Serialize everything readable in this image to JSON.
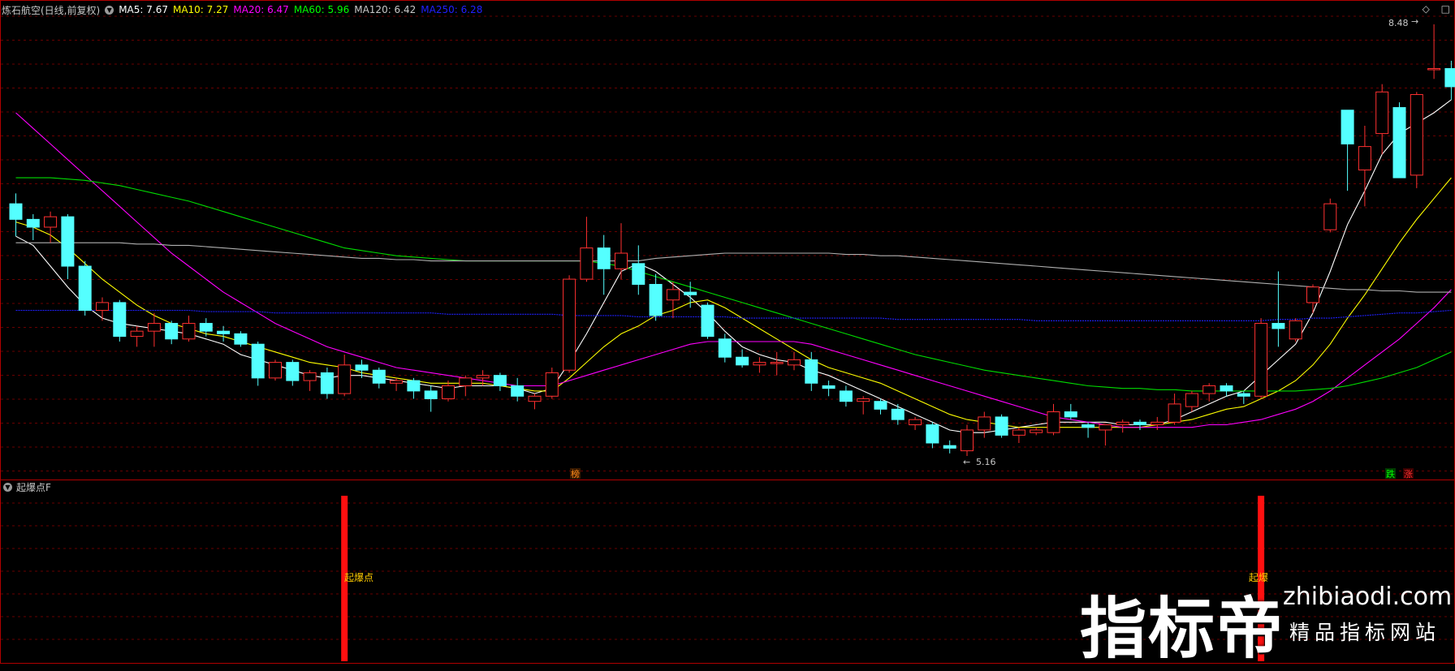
{
  "header": {
    "title": "炼石航空(日线,前复权)",
    "ma_indicators": [
      {
        "label": "MA5: 7.67",
        "color": "#ffffff"
      },
      {
        "label": "MA10: 7.27",
        "color": "#ffff00"
      },
      {
        "label": "MA20: 6.47",
        "color": "#ff00ff"
      },
      {
        "label": "MA60: 5.96",
        "color": "#00ff00"
      },
      {
        "label": "MA120: 6.42",
        "color": "#c8c8c8"
      },
      {
        "label": "MA250: 6.28",
        "color": "#0000ff"
      }
    ],
    "corner_icons": [
      "diamond-icon",
      "square-icon"
    ]
  },
  "main_chart": {
    "high_label": "8.48",
    "low_label": "5.16",
    "markers": [
      {
        "text": "榜",
        "color": "#ff8c1a"
      },
      {
        "text": "跌",
        "color": "#00ff00"
      },
      {
        "text": "涨",
        "color": "#ff3030"
      }
    ]
  },
  "sub_chart": {
    "title": "起爆点F",
    "signal_label": "起爆点",
    "signal_label_2": "起爆"
  },
  "watermark": {
    "brand": "指标帝",
    "url": "zhibiaodi.com",
    "slogan": "精品指标网站"
  },
  "colors": {
    "up": "#ff3030",
    "down": "#54ffff",
    "grid": "#8b0000",
    "border": "#b00000",
    "signal": "#ff1010"
  },
  "candles": [
    [
      7.1,
      7.18,
      6.85,
      6.98
    ],
    [
      6.98,
      7.02,
      6.82,
      6.92
    ],
    [
      6.92,
      7.04,
      6.8,
      7.0
    ],
    [
      7.0,
      7.02,
      6.52,
      6.62
    ],
    [
      6.62,
      6.66,
      6.24,
      6.28
    ],
    [
      6.28,
      6.38,
      6.2,
      6.34
    ],
    [
      6.34,
      6.36,
      6.04,
      6.08
    ],
    [
      6.08,
      6.16,
      6.0,
      6.12
    ],
    [
      6.12,
      6.26,
      6.0,
      6.18
    ],
    [
      6.18,
      6.2,
      6.02,
      6.06
    ],
    [
      6.06,
      6.24,
      6.04,
      6.18
    ],
    [
      6.18,
      6.22,
      6.08,
      6.12
    ],
    [
      6.12,
      6.16,
      6.04,
      6.1
    ],
    [
      6.1,
      6.12,
      6.0,
      6.02
    ],
    [
      6.02,
      6.04,
      5.7,
      5.76
    ],
    [
      5.76,
      5.9,
      5.74,
      5.88
    ],
    [
      5.88,
      5.9,
      5.7,
      5.74
    ],
    [
      5.74,
      5.82,
      5.66,
      5.8
    ],
    [
      5.8,
      5.84,
      5.6,
      5.64
    ],
    [
      5.64,
      5.94,
      5.62,
      5.86
    ],
    [
      5.86,
      5.9,
      5.76,
      5.82
    ],
    [
      5.82,
      5.84,
      5.68,
      5.72
    ],
    [
      5.72,
      5.76,
      5.66,
      5.74
    ],
    [
      5.74,
      5.76,
      5.6,
      5.66
    ],
    [
      5.66,
      5.7,
      5.5,
      5.6
    ],
    [
      5.6,
      5.74,
      5.58,
      5.7
    ],
    [
      5.7,
      5.78,
      5.62,
      5.76
    ],
    [
      5.76,
      5.82,
      5.7,
      5.78
    ],
    [
      5.78,
      5.8,
      5.66,
      5.7
    ],
    [
      5.7,
      5.76,
      5.58,
      5.62
    ],
    [
      5.58,
      5.64,
      5.52,
      5.62
    ],
    [
      5.62,
      5.84,
      5.6,
      5.8
    ],
    [
      5.82,
      6.55,
      5.8,
      6.52
    ],
    [
      6.52,
      7.0,
      6.5,
      6.76
    ],
    [
      6.76,
      6.86,
      6.4,
      6.6
    ],
    [
      6.6,
      6.95,
      6.52,
      6.72
    ],
    [
      6.64,
      6.78,
      6.4,
      6.48
    ],
    [
      6.48,
      6.56,
      6.2,
      6.24
    ],
    [
      6.36,
      6.5,
      6.22,
      6.44
    ],
    [
      6.42,
      6.5,
      6.3,
      6.4
    ],
    [
      6.32,
      6.34,
      6.06,
      6.08
    ],
    [
      6.06,
      6.1,
      5.88,
      5.92
    ],
    [
      5.92,
      5.98,
      5.84,
      5.86
    ],
    [
      5.86,
      5.92,
      5.8,
      5.88
    ],
    [
      5.88,
      5.96,
      5.78,
      5.88
    ],
    [
      5.86,
      5.96,
      5.82,
      5.9
    ],
    [
      5.9,
      5.96,
      5.66,
      5.72
    ],
    [
      5.7,
      5.74,
      5.62,
      5.68
    ],
    [
      5.66,
      5.7,
      5.54,
      5.58
    ],
    [
      5.58,
      5.62,
      5.48,
      5.6
    ],
    [
      5.58,
      5.6,
      5.48,
      5.52
    ],
    [
      5.52,
      5.56,
      5.4,
      5.44
    ],
    [
      5.4,
      5.46,
      5.36,
      5.44
    ],
    [
      5.4,
      5.42,
      5.22,
      5.26
    ],
    [
      5.24,
      5.28,
      5.18,
      5.22
    ],
    [
      5.2,
      5.4,
      5.16,
      5.36
    ],
    [
      5.36,
      5.5,
      5.3,
      5.46
    ],
    [
      5.46,
      5.48,
      5.3,
      5.32
    ],
    [
      5.32,
      5.38,
      5.26,
      5.36
    ],
    [
      5.34,
      5.38,
      5.32,
      5.36
    ],
    [
      5.34,
      5.56,
      5.32,
      5.5
    ],
    [
      5.5,
      5.56,
      5.44,
      5.46
    ],
    [
      5.4,
      5.42,
      5.3,
      5.38
    ],
    [
      5.36,
      5.4,
      5.24,
      5.4
    ],
    [
      5.4,
      5.44,
      5.34,
      5.42
    ],
    [
      5.42,
      5.44,
      5.36,
      5.4
    ],
    [
      5.4,
      5.46,
      5.36,
      5.42
    ],
    [
      5.42,
      5.64,
      5.4,
      5.56
    ],
    [
      5.54,
      5.66,
      5.5,
      5.64
    ],
    [
      5.64,
      5.72,
      5.58,
      5.7
    ],
    [
      5.7,
      5.72,
      5.62,
      5.66
    ],
    [
      5.64,
      5.66,
      5.56,
      5.62
    ],
    [
      5.62,
      6.22,
      5.6,
      6.18
    ],
    [
      6.18,
      6.58,
      6.0,
      6.14
    ],
    [
      6.06,
      6.22,
      6.04,
      6.2
    ],
    [
      6.34,
      6.48,
      6.26,
      6.46
    ],
    [
      6.9,
      7.14,
      6.88,
      7.1
    ],
    [
      7.82,
      7.82,
      7.2,
      7.56
    ],
    [
      7.36,
      7.7,
      7.08,
      7.54
    ],
    [
      7.64,
      8.02,
      7.48,
      7.96
    ],
    [
      7.84,
      7.88,
      7.3,
      7.3
    ],
    [
      7.32,
      7.96,
      7.22,
      7.94
    ],
    [
      8.14,
      8.48,
      8.06,
      8.14
    ],
    [
      8.14,
      8.2,
      7.9,
      8.0
    ]
  ],
  "ma_series": {
    "ma5": [
      6.85,
      6.78,
      6.62,
      6.46,
      6.32,
      6.22,
      6.18,
      6.16,
      6.14,
      6.12,
      6.1,
      6.06,
      6.02,
      5.94,
      5.9,
      5.86,
      5.82,
      5.78,
      5.76,
      5.78,
      5.78,
      5.76,
      5.74,
      5.72,
      5.7,
      5.68,
      5.7,
      5.7,
      5.7,
      5.68,
      5.64,
      5.68,
      5.88,
      6.1,
      6.34,
      6.58,
      6.64,
      6.58,
      6.48,
      6.38,
      6.26,
      6.12,
      6.0,
      5.94,
      5.9,
      5.88,
      5.82,
      5.78,
      5.72,
      5.66,
      5.6,
      5.54,
      5.48,
      5.42,
      5.36,
      5.34,
      5.34,
      5.36,
      5.38,
      5.4,
      5.42,
      5.42,
      5.42,
      5.42,
      5.4,
      5.4,
      5.4,
      5.44,
      5.5,
      5.56,
      5.62,
      5.66,
      5.78,
      5.9,
      6.02,
      6.26,
      6.58,
      6.94,
      7.2,
      7.48,
      7.64,
      7.72,
      7.8,
      7.9
    ],
    "ma10": [
      6.96,
      6.92,
      6.86,
      6.76,
      6.64,
      6.52,
      6.42,
      6.32,
      6.24,
      6.18,
      6.14,
      6.1,
      6.08,
      6.04,
      6.0,
      5.96,
      5.92,
      5.88,
      5.86,
      5.84,
      5.8,
      5.78,
      5.76,
      5.74,
      5.72,
      5.72,
      5.72,
      5.72,
      5.7,
      5.68,
      5.66,
      5.66,
      5.76,
      5.88,
      6.0,
      6.1,
      6.16,
      6.24,
      6.28,
      6.34,
      6.36,
      6.3,
      6.22,
      6.14,
      6.06,
      5.98,
      5.9,
      5.84,
      5.8,
      5.76,
      5.72,
      5.66,
      5.6,
      5.54,
      5.48,
      5.44,
      5.42,
      5.4,
      5.38,
      5.38,
      5.38,
      5.38,
      5.38,
      5.38,
      5.38,
      5.38,
      5.4,
      5.42,
      5.44,
      5.48,
      5.52,
      5.54,
      5.6,
      5.66,
      5.74,
      5.86,
      6.02,
      6.22,
      6.4,
      6.6,
      6.8,
      6.98,
      7.14,
      7.3
    ],
    "ma20": [
      7.8,
      7.68,
      7.56,
      7.44,
      7.32,
      7.2,
      7.08,
      6.96,
      6.84,
      6.72,
      6.62,
      6.52,
      6.42,
      6.34,
      6.26,
      6.18,
      6.12,
      6.06,
      6.0,
      5.96,
      5.92,
      5.88,
      5.84,
      5.82,
      5.8,
      5.78,
      5.76,
      5.74,
      5.72,
      5.7,
      5.7,
      5.7,
      5.74,
      5.78,
      5.82,
      5.86,
      5.9,
      5.94,
      5.98,
      6.02,
      6.04,
      6.04,
      6.04,
      6.04,
      6.04,
      6.04,
      6.02,
      5.98,
      5.94,
      5.9,
      5.86,
      5.82,
      5.78,
      5.74,
      5.7,
      5.66,
      5.62,
      5.58,
      5.54,
      5.5,
      5.46,
      5.44,
      5.42,
      5.4,
      5.38,
      5.38,
      5.38,
      5.38,
      5.38,
      5.4,
      5.4,
      5.42,
      5.44,
      5.48,
      5.52,
      5.58,
      5.66,
      5.76,
      5.86,
      5.96,
      6.06,
      6.18,
      6.3,
      6.44
    ],
    "ma60": [
      7.3,
      7.3,
      7.3,
      7.29,
      7.28,
      7.26,
      7.24,
      7.21,
      7.18,
      7.15,
      7.12,
      7.08,
      7.04,
      7.0,
      6.96,
      6.92,
      6.88,
      6.84,
      6.8,
      6.76,
      6.74,
      6.72,
      6.7,
      6.69,
      6.68,
      6.67,
      6.66,
      6.66,
      6.66,
      6.66,
      6.66,
      6.66,
      6.66,
      6.66,
      6.64,
      6.62,
      6.58,
      6.54,
      6.5,
      6.46,
      6.42,
      6.38,
      6.34,
      6.3,
      6.26,
      6.22,
      6.18,
      6.14,
      6.1,
      6.06,
      6.02,
      5.98,
      5.94,
      5.91,
      5.88,
      5.85,
      5.82,
      5.8,
      5.78,
      5.76,
      5.74,
      5.72,
      5.7,
      5.69,
      5.68,
      5.68,
      5.67,
      5.67,
      5.66,
      5.66,
      5.66,
      5.66,
      5.66,
      5.66,
      5.66,
      5.67,
      5.68,
      5.7,
      5.73,
      5.76,
      5.8,
      5.84,
      5.9,
      5.96
    ],
    "ma120": [
      6.8,
      6.8,
      6.8,
      6.8,
      6.8,
      6.8,
      6.8,
      6.79,
      6.79,
      6.78,
      6.78,
      6.77,
      6.76,
      6.75,
      6.74,
      6.73,
      6.72,
      6.71,
      6.7,
      6.69,
      6.68,
      6.68,
      6.67,
      6.67,
      6.66,
      6.66,
      6.66,
      6.66,
      6.66,
      6.66,
      6.66,
      6.66,
      6.66,
      6.66,
      6.66,
      6.66,
      6.66,
      6.68,
      6.69,
      6.7,
      6.71,
      6.72,
      6.72,
      6.72,
      6.72,
      6.72,
      6.72,
      6.72,
      6.71,
      6.71,
      6.7,
      6.7,
      6.69,
      6.68,
      6.67,
      6.66,
      6.65,
      6.64,
      6.63,
      6.62,
      6.61,
      6.6,
      6.59,
      6.58,
      6.57,
      6.56,
      6.55,
      6.54,
      6.53,
      6.52,
      6.51,
      6.5,
      6.49,
      6.48,
      6.47,
      6.46,
      6.45,
      6.44,
      6.44,
      6.43,
      6.43,
      6.42,
      6.42,
      6.42
    ],
    "ma250": [
      6.28,
      6.28,
      6.28,
      6.28,
      6.28,
      6.28,
      6.28,
      6.28,
      6.28,
      6.28,
      6.28,
      6.27,
      6.27,
      6.27,
      6.27,
      6.26,
      6.26,
      6.26,
      6.26,
      6.26,
      6.26,
      6.26,
      6.26,
      6.26,
      6.26,
      6.25,
      6.25,
      6.25,
      6.25,
      6.25,
      6.25,
      6.25,
      6.24,
      6.24,
      6.24,
      6.24,
      6.23,
      6.23,
      6.23,
      6.23,
      6.23,
      6.23,
      6.22,
      6.22,
      6.22,
      6.22,
      6.22,
      6.22,
      6.22,
      6.22,
      6.22,
      6.21,
      6.21,
      6.21,
      6.21,
      6.21,
      6.21,
      6.21,
      6.21,
      6.2,
      6.2,
      6.2,
      6.2,
      6.2,
      6.2,
      6.2,
      6.2,
      6.2,
      6.2,
      6.2,
      6.2,
      6.2,
      6.2,
      6.21,
      6.21,
      6.22,
      6.22,
      6.23,
      6.24,
      6.25,
      6.26,
      6.26,
      6.27,
      6.28
    ]
  },
  "signal_bars": [
    19,
    72
  ]
}
